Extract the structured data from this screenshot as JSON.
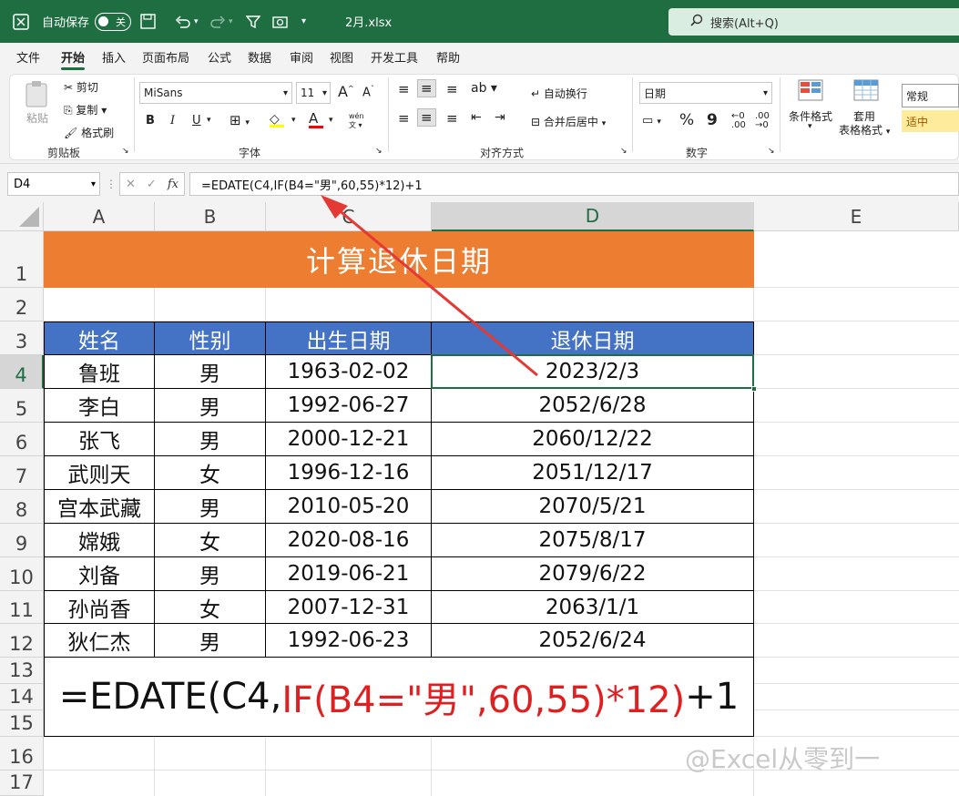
{
  "titlebar": {
    "autosave_label": "自动保存",
    "autosave_state": "关",
    "filename": "2月.xlsx",
    "search_placeholder": "搜索(Alt+Q)"
  },
  "menu": {
    "tabs": [
      "文件",
      "开始",
      "插入",
      "页面布局",
      "公式",
      "数据",
      "审阅",
      "视图",
      "开发工具",
      "帮助"
    ],
    "active": "开始"
  },
  "ribbon": {
    "clipboard": {
      "paste": "粘贴",
      "cut": "剪切",
      "copy": "复制",
      "format_painter": "格式刷",
      "group": "剪贴板"
    },
    "font": {
      "name": "MiSans",
      "size": "11",
      "bold": "B",
      "italic": "I",
      "underline": "U",
      "grow": "A",
      "shrink": "A",
      "group": "字体",
      "phonetic": "wén"
    },
    "alignment": {
      "wrap": "自动换行",
      "merge": "合并后居中",
      "group": "对齐方式"
    },
    "number": {
      "format": "日期",
      "percent": "%",
      "comma": "9",
      "group": "数字"
    },
    "styles": {
      "conditional": "条件格式",
      "table_line1": "套用",
      "table_line2": "表格格式",
      "normal": "常规",
      "neutral": "适中"
    }
  },
  "formula_bar": {
    "name_box": "D4",
    "fx": "fx",
    "formula": "=EDATE(C4,IF(B4=\"男\",60,55)*12)+1"
  },
  "columns": [
    "A",
    "B",
    "C",
    "D",
    "E"
  ],
  "rows": [
    "1",
    "2",
    "3",
    "4",
    "5",
    "6",
    "7",
    "8",
    "9",
    "10",
    "11",
    "12",
    "13",
    "14",
    "15",
    "16",
    "17"
  ],
  "sheet": {
    "title": "计算退休日期",
    "headers": [
      "姓名",
      "性别",
      "出生日期",
      "退休日期"
    ],
    "data": [
      [
        "鲁班",
        "男",
        "1963-02-02",
        "2023/2/3"
      ],
      [
        "李白",
        "男",
        "1992-06-27",
        "2052/6/28"
      ],
      [
        "张飞",
        "男",
        "2000-12-21",
        "2060/12/22"
      ],
      [
        "武则天",
        "女",
        "1996-12-16",
        "2051/12/17"
      ],
      [
        "宫本武藏",
        "男",
        "2010-05-20",
        "2070/5/21"
      ],
      [
        "嫦娥",
        "女",
        "2020-08-16",
        "2075/8/17"
      ],
      [
        "刘备",
        "男",
        "2019-06-21",
        "2079/6/22"
      ],
      [
        "孙尚香",
        "女",
        "2007-12-31",
        "2063/1/1"
      ],
      [
        "狄仁杰",
        "男",
        "1992-06-23",
        "2052/6/24"
      ]
    ],
    "formula_display": {
      "prefix": "=EDATE(C4,",
      "highlight": "IF(B4=\"男\",60,55)*12)",
      "suffix": "+1"
    }
  },
  "watermark": "@Excel从零到一",
  "colors": {
    "title_bg": "#ed7d31",
    "header_bg": "#4472c4",
    "accent": "#1e6e42",
    "arrow": "#e53935"
  }
}
